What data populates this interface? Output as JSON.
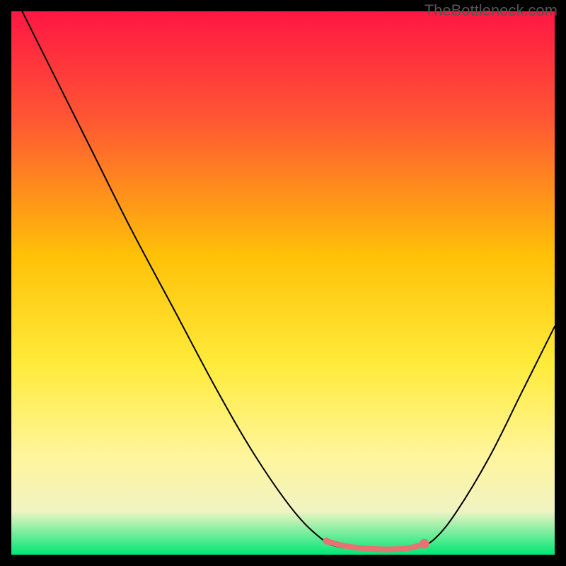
{
  "watermark": "TheBottleneck.com",
  "chart_data": {
    "type": "line",
    "title": "",
    "xlabel": "",
    "ylabel": "",
    "xlim": [
      0,
      100
    ],
    "ylim": [
      0,
      100
    ],
    "background_gradient": {
      "stops": [
        {
          "offset": 0,
          "color": "#ff1744"
        },
        {
          "offset": 20,
          "color": "#ff5733"
        },
        {
          "offset": 45,
          "color": "#ffc107"
        },
        {
          "offset": 65,
          "color": "#ffeb3b"
        },
        {
          "offset": 82,
          "color": "#fff59d"
        },
        {
          "offset": 92,
          "color": "#f0f4c3"
        },
        {
          "offset": 100,
          "color": "#00e676"
        }
      ]
    },
    "series": [
      {
        "name": "bottleneck-curve",
        "color": "#000000",
        "width": 2,
        "data": [
          {
            "x": 2,
            "y": 100
          },
          {
            "x": 8,
            "y": 88
          },
          {
            "x": 15,
            "y": 74
          },
          {
            "x": 22,
            "y": 60
          },
          {
            "x": 30,
            "y": 45
          },
          {
            "x": 38,
            "y": 30
          },
          {
            "x": 45,
            "y": 18
          },
          {
            "x": 52,
            "y": 8
          },
          {
            "x": 57,
            "y": 3
          },
          {
            "x": 60,
            "y": 1.5
          },
          {
            "x": 65,
            "y": 1
          },
          {
            "x": 70,
            "y": 1
          },
          {
            "x": 75,
            "y": 1.5
          },
          {
            "x": 78,
            "y": 3
          },
          {
            "x": 82,
            "y": 8
          },
          {
            "x": 88,
            "y": 18
          },
          {
            "x": 94,
            "y": 30
          },
          {
            "x": 100,
            "y": 42
          }
        ]
      },
      {
        "name": "highlight-segment",
        "color": "#e57373",
        "width": 8,
        "data": [
          {
            "x": 58,
            "y": 2.5
          },
          {
            "x": 62,
            "y": 1.5
          },
          {
            "x": 68,
            "y": 1
          },
          {
            "x": 73,
            "y": 1.2
          },
          {
            "x": 76,
            "y": 2
          }
        ],
        "marker_start": {
          "x": 58,
          "y": 2.5,
          "r": 5
        },
        "marker_end": {
          "x": 76,
          "y": 2,
          "r": 7
        }
      }
    ]
  }
}
